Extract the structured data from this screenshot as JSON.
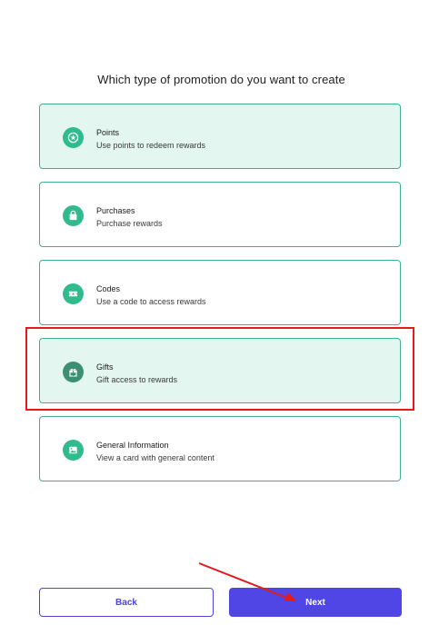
{
  "heading": "Which type of promotion do you want to create",
  "options": [
    {
      "title": "Points",
      "subtitle": "Use points to redeem rewards",
      "icon": "star-icon",
      "selected": true
    },
    {
      "title": "Purchases",
      "subtitle": "Purchase rewards",
      "icon": "shopping-bag-icon",
      "selected": false
    },
    {
      "title": "Codes",
      "subtitle": "Use a code to access rewards",
      "icon": "ticket-icon",
      "selected": false
    },
    {
      "title": "Gifts",
      "subtitle": "Gift access to rewards",
      "icon": "gift-icon",
      "selected": true
    },
    {
      "title": "General Information",
      "subtitle": "View a card with general content",
      "icon": "image-icon",
      "selected": false
    }
  ],
  "buttons": {
    "back": "Back",
    "next": "Next"
  },
  "colors": {
    "accent_green": "#2fbb8b",
    "selected_bg": "#e3f7f0",
    "primary": "#4f46e5",
    "annotation_red": "#e31b1b"
  }
}
